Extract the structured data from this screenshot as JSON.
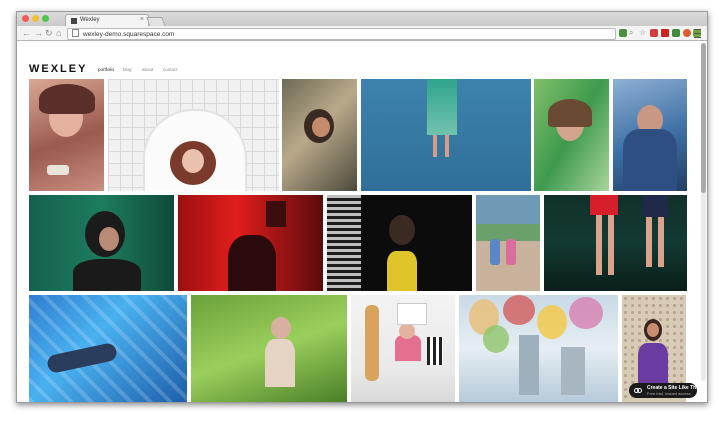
{
  "browser": {
    "tab_title": "Wexley",
    "url": "wexley-demo.squarespace.com"
  },
  "site": {
    "logo": "WEXLEY",
    "nav": [
      {
        "label": "portfolio",
        "active": true
      },
      {
        "label": "blog",
        "active": false
      },
      {
        "label": "about",
        "active": false
      },
      {
        "label": "contact",
        "active": false
      }
    ]
  },
  "badge": {
    "title": "Create a Site Like This",
    "subtitle": "Free trial. Instant access."
  },
  "colors": {
    "accent_blue": "#3a6fb3",
    "page_bg": "#ffffff"
  }
}
